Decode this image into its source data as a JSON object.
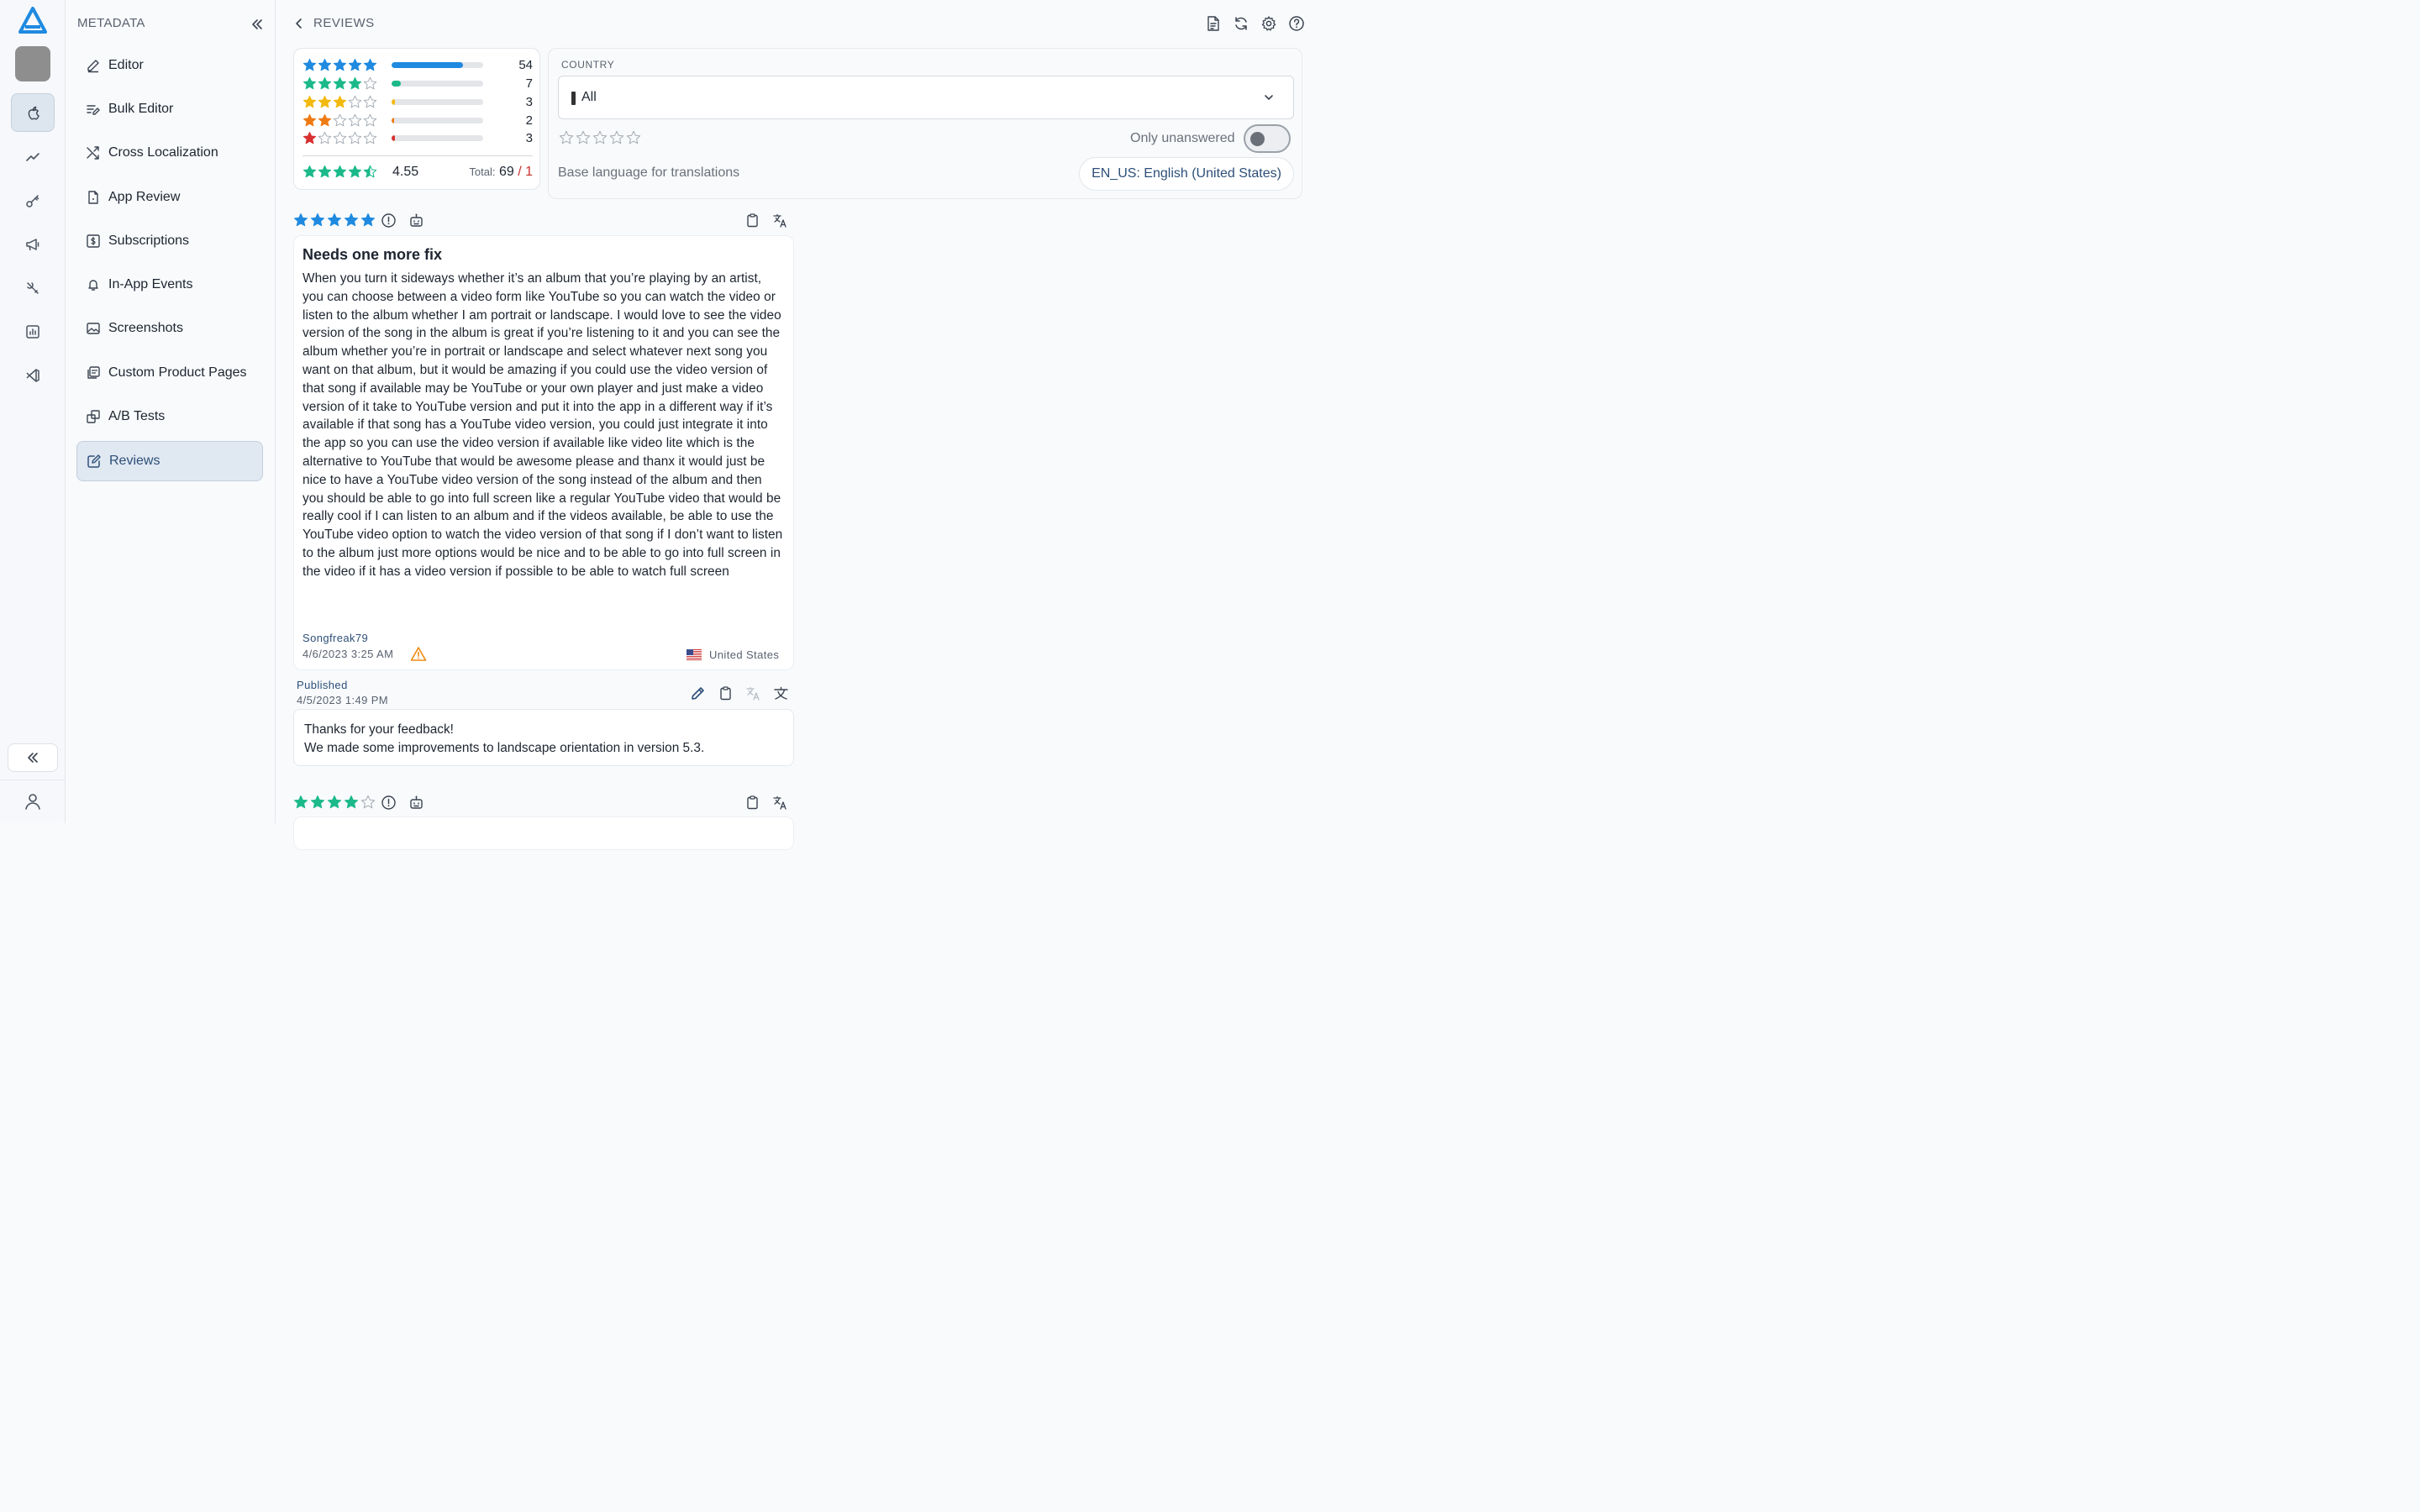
{
  "sidebar": {
    "title": "METADATA",
    "items": [
      {
        "label": "Editor",
        "icon": "pencil-icon"
      },
      {
        "label": "Bulk Editor",
        "icon": "bulk-edit-icon"
      },
      {
        "label": "Cross Localization",
        "icon": "shuffle-icon"
      },
      {
        "label": "App Review",
        "icon": "document-icon"
      },
      {
        "label": "Subscriptions",
        "icon": "dollar-document-icon"
      },
      {
        "label": "In-App Events",
        "icon": "bell-icon"
      },
      {
        "label": "Screenshots",
        "icon": "image-icon"
      },
      {
        "label": "Custom Product Pages",
        "icon": "pages-icon"
      },
      {
        "label": "A/B Tests",
        "icon": "ab-test-icon"
      },
      {
        "label": "Reviews",
        "icon": "reviews-icon"
      }
    ],
    "active": "Reviews"
  },
  "header": {
    "title": "REVIEWS"
  },
  "rating_summary": {
    "rows": [
      {
        "stars": 5,
        "count": "54",
        "fraction": 0.78,
        "color": "#1f8ae0"
      },
      {
        "stars": 4,
        "count": "7",
        "fraction": 0.1,
        "color": "#1cb98a"
      },
      {
        "stars": 3,
        "count": "3",
        "fraction": 0.04,
        "color": "#f2b90f"
      },
      {
        "stars": 2,
        "count": "2",
        "fraction": 0.03,
        "color": "#ef7a12"
      },
      {
        "stars": 1,
        "count": "3",
        "fraction": 0.04,
        "color": "#d93030"
      }
    ],
    "average": "4.55",
    "average_stars": 4.5,
    "total_label": "Total:",
    "total": "69",
    "slash": "/",
    "unanswered": "1"
  },
  "filters": {
    "country_label": "COUNTRY",
    "country_value": "All",
    "only_unanswered_label": "Only unanswered",
    "only_unanswered": false,
    "base_language_label": "Base language for translations",
    "base_language_value": "EN_US: English (United States)"
  },
  "reviews": [
    {
      "stars": 5,
      "title": "Needs one more fix",
      "body": "When you turn it sideways whether it’s an album that you’re playing by an artist, you can choose between a video form like YouTube so you can watch the video or listen to the album whether I am portrait or landscape. I would love to see the video version of the song in the album is great if you’re listening to it and you can see the album whether you’re in portrait or landscape and select whatever next song you want on that album, but it would be amazing if you could use the video version of that song if available may be YouTube or your own player and just make a video version of it take to YouTube version and put it into the app in a different way if it’s available if that song has a YouTube video version, you could just integrate it into the app so you can use the video version if available like video lite which is the alternative to YouTube that would be awesome please and thanx it would just be nice to have a YouTube video version of the song instead of the album and then you should be able to go into full screen like a regular YouTube video that would be really cool if I can listen to an album and if the videos available, be able to use the YouTube video option to watch the video version of that song if I don’t want to listen to the album just more options would be nice and to be able to go into full screen in the video if it has a video version if possible to be able to watch full screen",
      "author": "Songfreak79",
      "date": "4/6/2023 3:25 AM",
      "country": "United States",
      "reply": {
        "status": "Published",
        "date": "4/5/2023 1:49 PM",
        "line1": "Thanks for your feedback!",
        "line2": "We made some improvements to landscape orientation in version 5.3."
      }
    },
    {
      "stars": 4
    }
  ]
}
